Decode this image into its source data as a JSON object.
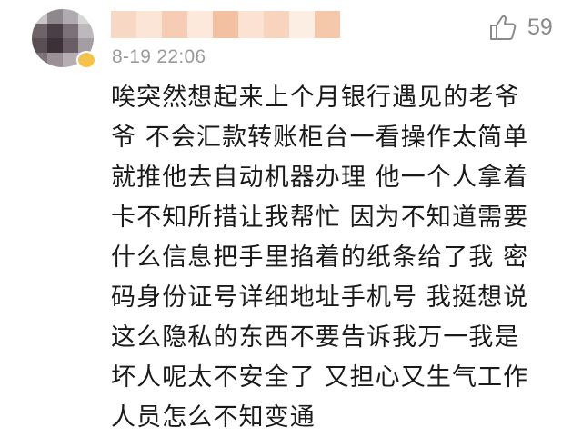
{
  "comment": {
    "timestamp": "8-19 22:06",
    "like_count": "59",
    "text": "唉突然想起来上个月银行遇见的老爷\n爷 不会汇款转账柜台一看操作太简单\n就推他去自动机器办理 他一个人拿着\n卡不知所措让我帮忙 因为不知道需要\n什么信息把手里掐着的纸条给了我 密\n码身份证号详细地址手机号 我挺想说\n这么隐私的东西不要告诉我万一我是\n坏人呢太不安全了 又担心又生气工作\n人员怎么不知变通"
  },
  "colors": {
    "timestamp": "#9a9a9a",
    "like": "#8a8a8a",
    "text": "#1a1a1a"
  },
  "icons": {
    "like": "thumbs-up-icon"
  }
}
